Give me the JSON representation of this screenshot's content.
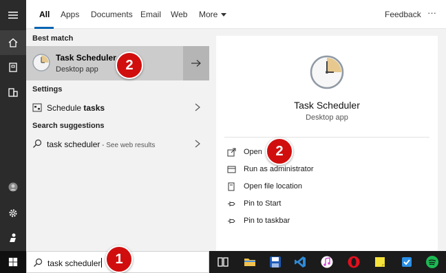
{
  "tabs": [
    {
      "label": "All",
      "active": true
    },
    {
      "label": "Apps"
    },
    {
      "label": "Documents"
    },
    {
      "label": "Email"
    },
    {
      "label": "Web"
    },
    {
      "label": "More"
    }
  ],
  "header": {
    "feedback_label": "Feedback",
    "more_options": "···"
  },
  "results": {
    "best_match_heading": "Best match",
    "best_match": {
      "title": "Task Scheduler",
      "subtitle": "Desktop app"
    },
    "settings_heading": "Settings",
    "settings_item": {
      "prefix": "Schedule ",
      "bold": "tasks"
    },
    "suggestions_heading": "Search suggestions",
    "suggestion": {
      "text": "task scheduler",
      "hint": " - See web results"
    }
  },
  "detail": {
    "title": "Task Scheduler",
    "subtitle": "Desktop app",
    "actions": [
      "Open",
      "Run as administrator",
      "Open file location",
      "Pin to Start",
      "Pin to taskbar"
    ]
  },
  "search": {
    "value": "task scheduler"
  },
  "callouts": [
    "1",
    "2",
    "2"
  ],
  "colors": {
    "accent": "#0063b1",
    "callout": "#d10e0e",
    "highlight": "#cccccc"
  },
  "taskbar_icons": [
    "task-view-icon",
    "file-explorer-icon",
    "save-app-icon",
    "vscode-icon",
    "itunes-icon",
    "opera-icon",
    "sticky-notes-icon",
    "todo-icon",
    "spotify-icon"
  ]
}
